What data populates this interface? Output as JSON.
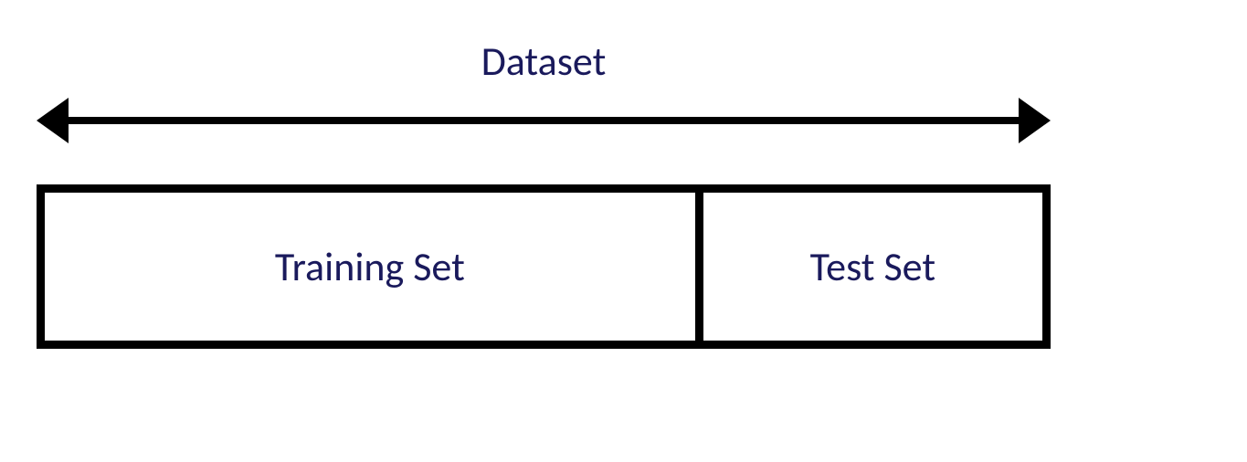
{
  "diagram": {
    "title": "Dataset",
    "training_label": "Training Set",
    "test_label": "Test Set"
  }
}
